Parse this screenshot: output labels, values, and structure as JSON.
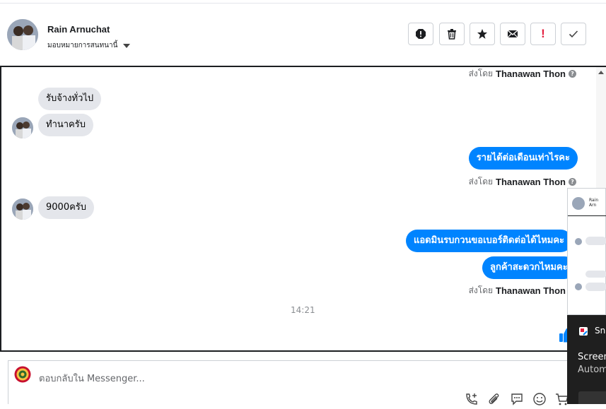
{
  "header": {
    "contact_name": "Rain Arnuchat",
    "assign_label": "มอบหมายการสนทนานี้",
    "buttons": [
      "spam-report",
      "delete",
      "star",
      "mark-unread",
      "important",
      "done"
    ],
    "important_glyph": "!"
  },
  "conversation": {
    "sent_by_prefix": "ส่งโดย",
    "sent_by_name": "Thanawan Thon",
    "sent_by_help": "?",
    "incoming_1": [
      "รับจ้างทั่วไป",
      "ทำนาครับ"
    ],
    "outgoing_1": [
      "รายได้ต่อเดือนเท่าไรคะ"
    ],
    "incoming_2": [
      "9000ครับ"
    ],
    "outgoing_2": [
      "แอดมินรบกวนขอเบอร์ติดต่อได้ไหมคะ",
      "ลูกค้าสะดวกไหมคะ"
    ],
    "timestamp": "14:21",
    "like_icon": "thumbs-up-icon"
  },
  "reply": {
    "placeholder": "ตอบกลับใน Messenger...",
    "icons": [
      "phone-plus-icon",
      "paperclip-icon",
      "chat-bubble-icon",
      "emoji-icon",
      "cart-icon"
    ]
  },
  "overlay": {
    "preview_name": "Rain Arn",
    "snip_label": "Sni",
    "screen_label": "Screen",
    "auto_label": "Autom"
  },
  "colors": {
    "accent": "#0084ff",
    "important": "#e41e3f",
    "bubble_in": "#e4e6eb"
  }
}
